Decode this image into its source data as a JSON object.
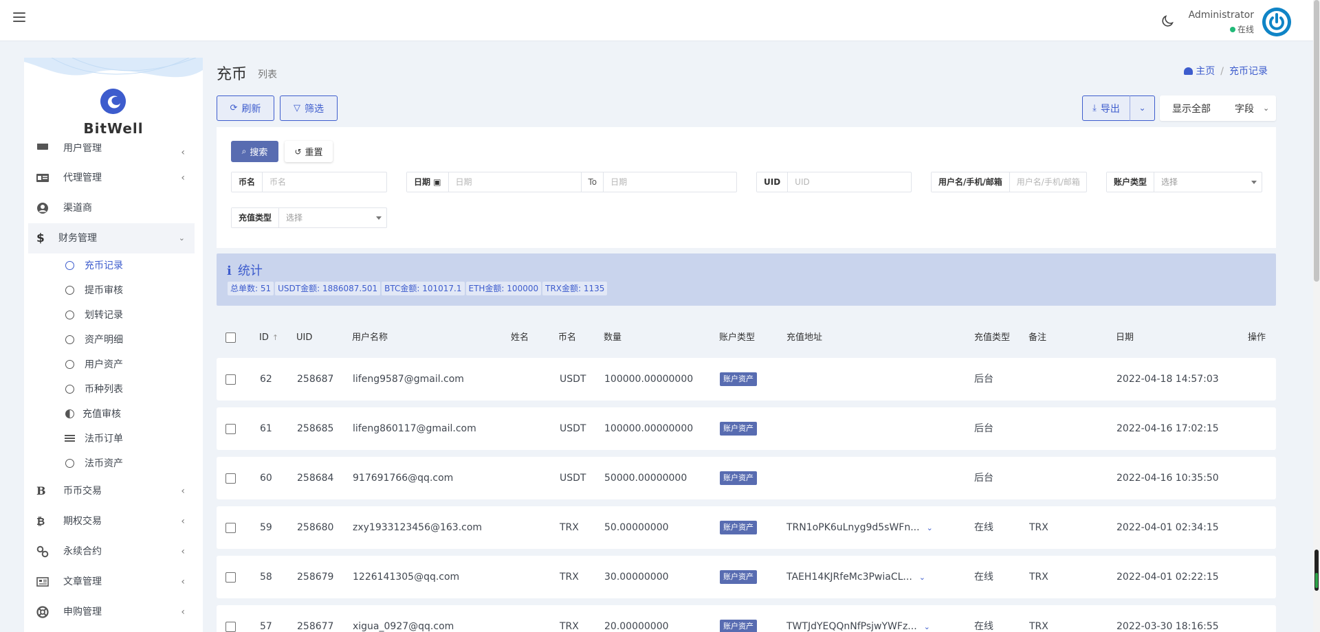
{
  "header": {
    "admin_name": "Administrator",
    "status": "在线"
  },
  "sidebar": {
    "brand": "BitWell",
    "menu": [
      {
        "label": "用户管理",
        "icon": "users-icon"
      },
      {
        "label": "代理管理",
        "icon": "id-card-icon"
      },
      {
        "label": "渠道商",
        "icon": "user-circle-icon"
      },
      {
        "label": "财务管理",
        "icon": "dollar-icon"
      }
    ],
    "finance_sub": [
      {
        "label": "充币记录",
        "icon": "circle-icon"
      },
      {
        "label": "提币审核",
        "icon": "circle-icon"
      },
      {
        "label": "划转记录",
        "icon": "circle-icon"
      },
      {
        "label": "资产明细",
        "icon": "circle-icon"
      },
      {
        "label": "用户资产",
        "icon": "circle-icon"
      },
      {
        "label": "币种列表",
        "icon": "circle-icon"
      },
      {
        "label": "充值审核",
        "icon": "half-circle-icon"
      },
      {
        "label": "法币订单",
        "icon": "bars-icon"
      },
      {
        "label": "法币资产",
        "icon": "circle-icon"
      }
    ],
    "menu_bottom": [
      {
        "label": "币币交易",
        "icon": "b-icon"
      },
      {
        "label": "期权交易",
        "icon": "bitcoin-icon"
      },
      {
        "label": "永续合约",
        "icon": "link-icon"
      },
      {
        "label": "文章管理",
        "icon": "newspaper-icon"
      },
      {
        "label": "申购管理",
        "icon": "lifebuoy-icon"
      }
    ]
  },
  "page": {
    "title": "充币",
    "subtitle": "列表",
    "breadcrumb_home": "主页",
    "breadcrumb_current": "充币记录"
  },
  "toolbar": {
    "refresh": "刷新",
    "filter": "筛选",
    "export": "导出",
    "show_all": "显示全部",
    "fields": "字段"
  },
  "filters": {
    "search": "搜索",
    "reset": "重置",
    "coin_label": "币名",
    "coin_placeholder": "币名",
    "date_label": "日期",
    "date_placeholder": "日期",
    "to": "To",
    "date_to_placeholder": "日期",
    "uid_label": "UID",
    "uid_placeholder": "UID",
    "user_label": "用户名/手机/邮箱",
    "user_placeholder": "用户名/手机/邮箱",
    "account_type_label": "账户类型",
    "account_type_placeholder": "选择",
    "recharge_type_label": "充值类型",
    "recharge_type_placeholder": "选择"
  },
  "stats": {
    "title": "统计",
    "items": [
      "总单数: 51",
      "USDT金额: 1886087.501",
      "BTC金额: 101017.1",
      "ETH金额: 100000",
      "TRX金额: 1135"
    ]
  },
  "table": {
    "columns": {
      "id": "ID",
      "uid": "UID",
      "username": "用户名称",
      "name": "姓名",
      "coin": "币名",
      "amount": "数量",
      "account_type": "账户类型",
      "address": "充值地址",
      "recharge_type": "充值类型",
      "remark": "备注",
      "date": "日期",
      "action": "操作"
    },
    "rows": [
      {
        "id": "62",
        "uid": "258687",
        "username": "lifeng9587@gmail.com",
        "coin": "USDT",
        "amount": "100000.00000000",
        "account_type": "账户资产",
        "address": "",
        "recharge_type": "后台",
        "remark": "",
        "date": "2022-04-18 14:57:03"
      },
      {
        "id": "61",
        "uid": "258685",
        "username": "lifeng860117@gmail.com",
        "coin": "USDT",
        "amount": "100000.00000000",
        "account_type": "账户资产",
        "address": "",
        "recharge_type": "后台",
        "remark": "",
        "date": "2022-04-16 17:02:15"
      },
      {
        "id": "60",
        "uid": "258684",
        "username": "917691766@qq.com",
        "coin": "USDT",
        "amount": "50000.00000000",
        "account_type": "账户资产",
        "address": "",
        "recharge_type": "后台",
        "remark": "",
        "date": "2022-04-16 10:35:50"
      },
      {
        "id": "59",
        "uid": "258680",
        "username": "zxy1933123456@163.com",
        "coin": "TRX",
        "amount": "50.00000000",
        "account_type": "账户资产",
        "address": "TRN1oPK6uLnyg9d5sWFn...",
        "recharge_type": "在线",
        "remark": "TRX",
        "date": "2022-04-01 02:34:15"
      },
      {
        "id": "58",
        "uid": "258679",
        "username": "1226141305@qq.com",
        "coin": "TRX",
        "amount": "30.00000000",
        "account_type": "账户资产",
        "address": "TAEH14KJRfeMc3PwiaCL...",
        "recharge_type": "在线",
        "remark": "TRX",
        "date": "2022-04-01 02:22:15"
      },
      {
        "id": "57",
        "uid": "258677",
        "username": "xigua_0927@qq.com",
        "coin": "TRX",
        "amount": "20.00000000",
        "account_type": "账户资产",
        "address": "TWTJdYEQQnNfPsjwYWFz...",
        "recharge_type": "在线",
        "remark": "TRX",
        "date": "2022-03-30 18:16:55"
      }
    ]
  }
}
